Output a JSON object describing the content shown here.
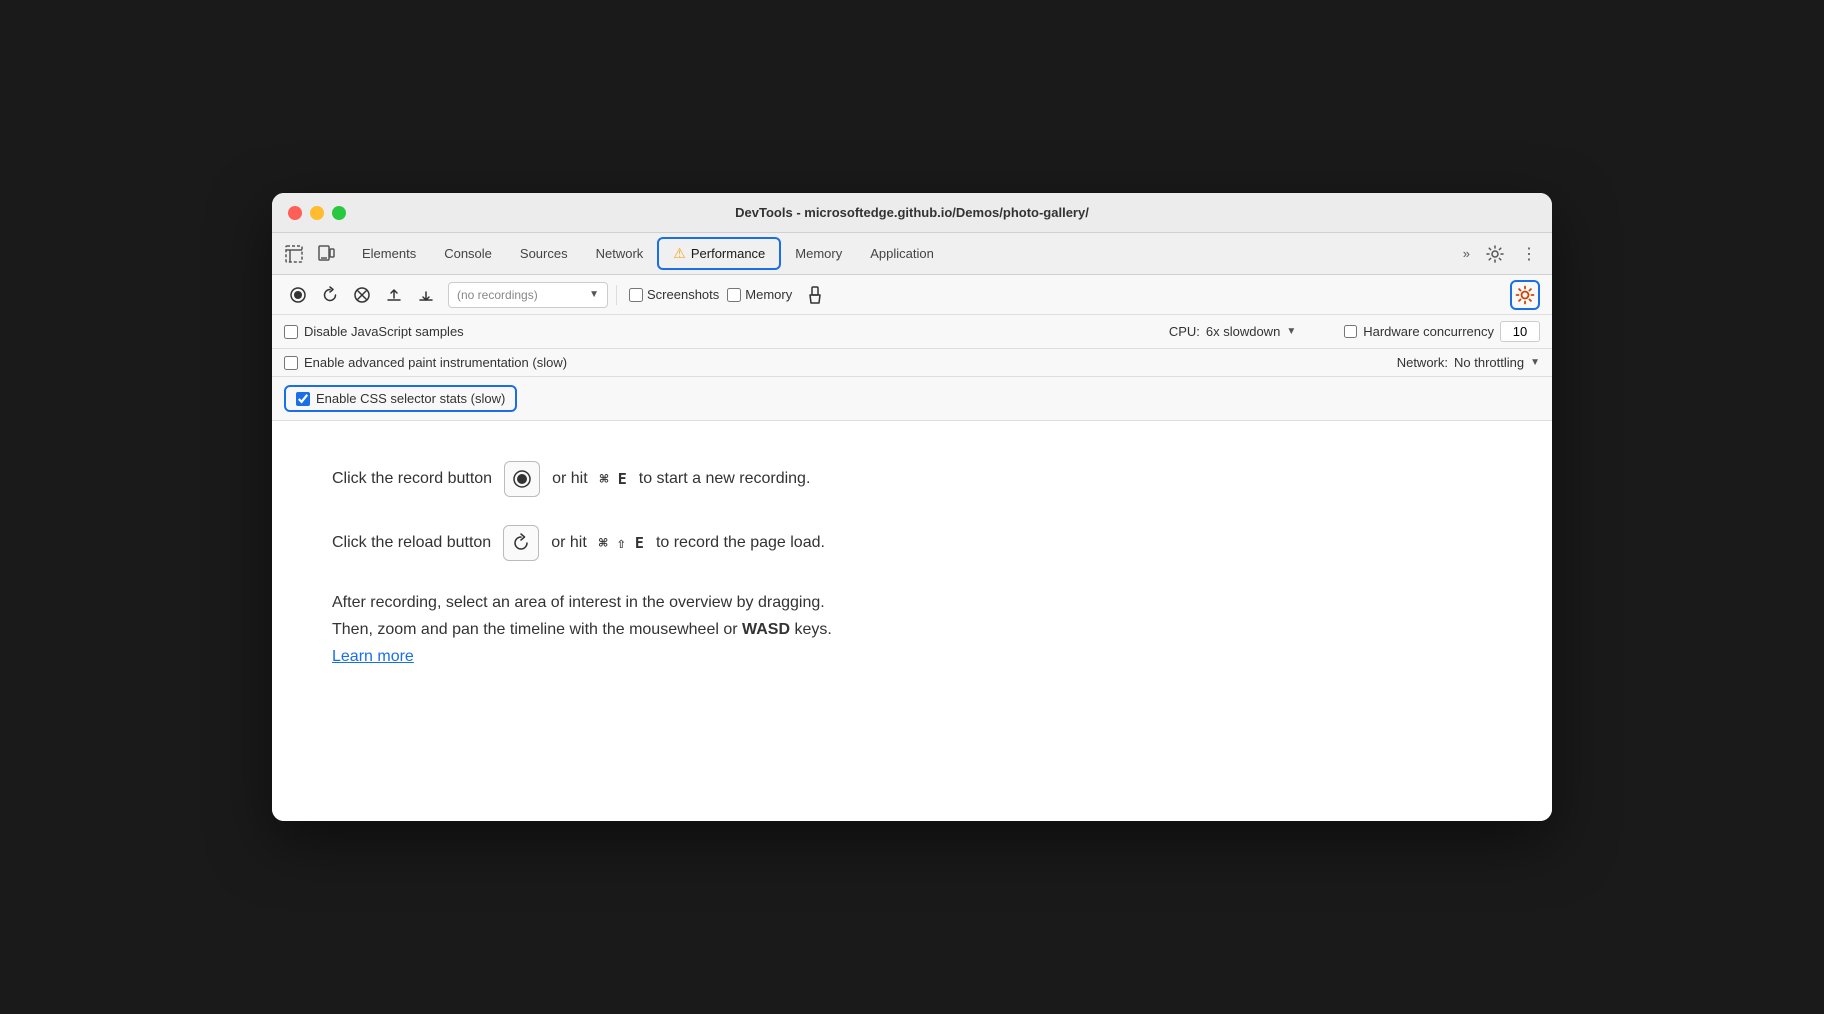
{
  "window": {
    "title": "DevTools - microsoftedge.github.io/Demos/photo-gallery/"
  },
  "tabs": [
    {
      "id": "elements",
      "label": "Elements",
      "active": false
    },
    {
      "id": "console",
      "label": "Console",
      "active": false
    },
    {
      "id": "sources",
      "label": "Sources",
      "active": false
    },
    {
      "id": "network",
      "label": "Network",
      "active": false
    },
    {
      "id": "performance",
      "label": "Performance",
      "active": true,
      "warn": true
    },
    {
      "id": "memory",
      "label": "Memory",
      "active": false
    },
    {
      "id": "application",
      "label": "Application",
      "active": false
    }
  ],
  "toolbar": {
    "recording_placeholder": "(no recordings)",
    "screenshots_label": "Screenshots",
    "memory_label": "Memory"
  },
  "settings": {
    "disable_js_samples": {
      "label": "Disable JavaScript samples",
      "checked": false
    },
    "enable_paint": {
      "label": "Enable advanced paint instrumentation (slow)",
      "checked": false
    },
    "enable_css_stats": {
      "label": "Enable CSS selector stats (slow)",
      "checked": true
    },
    "cpu_label": "CPU:",
    "cpu_value": "6x slowdown",
    "network_label": "Network:",
    "network_value": "No throttling",
    "hardware_label": "Hardware concurrency",
    "hardware_value": "10"
  },
  "instructions": {
    "line1_pre": "Click the record button",
    "line1_or": "or hit",
    "line1_shortcut": "⌘ E",
    "line1_post": "to start a new recording.",
    "line2_pre": "Click the reload button",
    "line2_or": "or hit",
    "line2_shortcut": "⌘ ⇧ E",
    "line2_post": "to record the page load.",
    "line3": "After recording, select an area of interest in the overview by dragging.",
    "line4_pre": "Then, zoom and pan the timeline with the mousewheel or",
    "line4_keys": "WASD",
    "line4_post": "keys.",
    "learn_more": "Learn more"
  },
  "icons": {
    "record": "⏺",
    "reload": "↺",
    "clear": "⊘",
    "upload": "↑",
    "download": "↓",
    "settings": "⚙",
    "more": "⋮",
    "overflow": "»",
    "inspector": "⬚",
    "device": "□",
    "broom": "🧹",
    "gear_red": "⚙"
  },
  "colors": {
    "accent_blue": "#1a6fe8",
    "warn_orange": "#f5a623",
    "gear_red": "#d44000"
  }
}
